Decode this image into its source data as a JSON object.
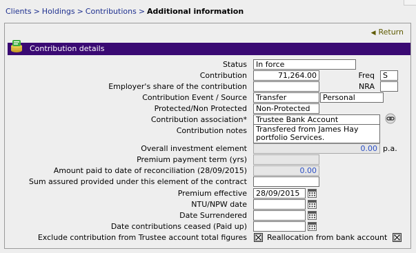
{
  "breadcrumb": {
    "items": [
      "Clients",
      "Holdings",
      "Contributions"
    ],
    "current": "Additional information",
    "separator": ">"
  },
  "panel": {
    "return_label": "Return",
    "section_title": "Contribution details"
  },
  "form": {
    "status": {
      "label": "Status",
      "value": "In force"
    },
    "contribution": {
      "label": "Contribution",
      "value": "71,264.00"
    },
    "freq": {
      "label": "Freq",
      "value": "S"
    },
    "employer_share": {
      "label": "Employer's share of the contribution",
      "value": ""
    },
    "nra": {
      "label": "NRA",
      "value": ""
    },
    "event_source": {
      "label": "Contribution Event / Source",
      "event": "Transfer",
      "source": "Personal"
    },
    "protected": {
      "label": "Protected/Non Protected",
      "value": "Non-Protected"
    },
    "association": {
      "label": "Contribution association*",
      "value": "Trustee Bank Account"
    },
    "notes": {
      "label": "Contribution notes",
      "line1": "Transfered from James Hay",
      "line2": "portfolio Services."
    },
    "overall_investment": {
      "label": "Overall investment element",
      "value": "0.00",
      "suffix": "p.a."
    },
    "premium_term": {
      "label": "Premium payment term (yrs)",
      "value": ""
    },
    "amount_paid": {
      "label": "Amount paid to date of reconciliation (28/09/2015)",
      "value": "0.00"
    },
    "sum_assured": {
      "label": "Sum assured provided under this element of the contract",
      "value": ""
    },
    "premium_effective": {
      "label": "Premium effective",
      "value": "28/09/2015"
    },
    "ntu_npw": {
      "label": "NTU/NPW date",
      "value": ""
    },
    "date_surrendered": {
      "label": "Date Surrendered",
      "value": ""
    },
    "date_ceased": {
      "label": "Date contributions ceased (Paid up)",
      "value": ""
    },
    "exclude_trustee": {
      "label": "Exclude contribution from Trustee account total figures",
      "checked": true
    },
    "reallocation": {
      "label": "Reallocation from bank account",
      "checked": true
    }
  },
  "colors": {
    "header_bg": "#3a0a73",
    "link": "#1d2f8f",
    "return": "#5e5a00",
    "blue_value": "#2b4fc4"
  },
  "icons": [
    "contribution-details-icon",
    "return-arrow-icon",
    "link-chain-icon",
    "calendar-icon",
    "checkbox-x-icon"
  ]
}
